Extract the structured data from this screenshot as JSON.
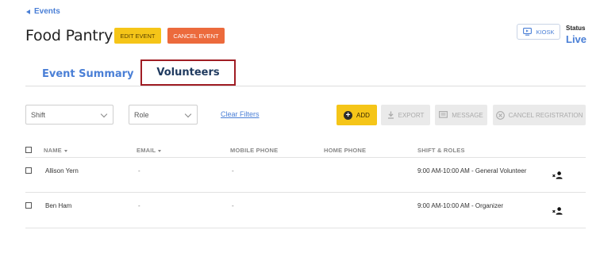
{
  "nav": {
    "back_label": "Events"
  },
  "event": {
    "title": "Food Pantry",
    "edit_label": "EDIT EVENT",
    "cancel_label": "CANCEL EVENT",
    "kiosk_label": "KIOSK",
    "status_label": "Status",
    "status_value": "Live"
  },
  "tabs": [
    {
      "label": "Event Summary"
    },
    {
      "label": "Volunteers"
    }
  ],
  "filters": {
    "shift_value": "Shift",
    "role_value": "Role",
    "clear_label": "Clear Filters"
  },
  "toolbar": {
    "add_label": "ADD",
    "export_label": "EXPORT",
    "message_label": "MESSAGE",
    "cancel_registration_label": "CANCEL REGISTRATION"
  },
  "table": {
    "columns": [
      "NAME",
      "EMAIL",
      "MOBILE PHONE",
      "HOME PHONE",
      "SHIFT & ROLES"
    ],
    "rows": [
      {
        "name": "Allison Yern",
        "email": "-",
        "mobile": "-",
        "home": "",
        "shift_roles": "9:00 AM-10:00 AM - General Volunteer"
      },
      {
        "name": "Ben Ham",
        "email": "-",
        "mobile": "-",
        "home": "",
        "shift_roles": "9:00 AM-10:00 AM - Organizer"
      }
    ]
  },
  "colors": {
    "accent_blue": "#4a7fd6",
    "yellow": "#f5c518",
    "orange": "#ec6a3c",
    "tab_highlight": "#a01d24"
  }
}
